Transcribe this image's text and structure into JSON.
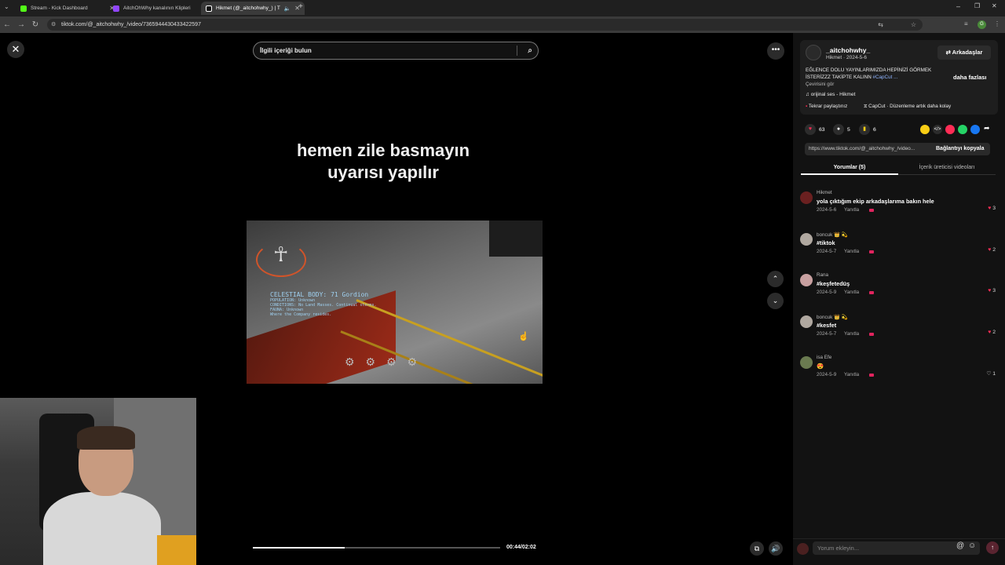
{
  "browser": {
    "tabs": [
      {
        "title": "Stream - Kick Dashboard",
        "color": "#53fc18"
      },
      {
        "title": "AitchOhWhy kanalının Klipleri",
        "color": "#9146ff"
      },
      {
        "title": "Hikmet (@_aitchohwhy_) | T",
        "color": "#ffffff"
      }
    ],
    "url": "tiktok.com/@_aitchohwhy_/video/7365944430433422597",
    "profile_initial": "G"
  },
  "search": {
    "placeholder": "İlgili içeriği bulun"
  },
  "video": {
    "caption_line1": "hemen zile basmayın",
    "caption_line2": "uyarısı yapılır",
    "hud_line1": "CELESTIAL BODY: 71 Gordion",
    "hud_line2": "POPULATION: Unknown",
    "hud_line3": "CONDITIONS: No Land Masses. Continual storms.",
    "hud_line4": "FAUNA: Unknown",
    "hud_line5": "Where the Company resides.",
    "progress": 0.37,
    "time": "00:44/02:02"
  },
  "post": {
    "username": "_aitchohwhy_",
    "meta": "Hikmet · 2024-5-6",
    "friends_label": "Arkadaşlar",
    "description": "EĞLENCE DOLU YAYINLARIMIZDA HEPİNİZİ GÖRMEK İSTERİZZZ TAKİPTE KALINN",
    "hashtag": "#CapCut ...",
    "more_label": "daha fazlası",
    "translate_label": "Çevirisini gör",
    "music": "orijinal ses - Hikmet",
    "repost_label": "Tekrar paylaştınız",
    "capcut_label": "CapCut · Düzenleme artık daha kolay",
    "likes": "63",
    "comments": "5",
    "saves": "6",
    "link": "https://www.tiktok.com/@_aitchohwhy_/video...",
    "copy_label": "Bağlantıyı kopyala",
    "tab_comments": "Yorumlar (5)",
    "tab_creator": "İçerik üreticisi videoları"
  },
  "comments": [
    {
      "user": "Hikmet",
      "text": "yola çıktığım ekip arkadaşlarıma bakın hele",
      "date": "2024-5-6",
      "reply": "Yanıtla",
      "likes": "3",
      "liked": true,
      "avatar_color": "#6a2020"
    },
    {
      "user": "boncuk 👑 💫",
      "text": "#tiktok",
      "date": "2024-5-7",
      "reply": "Yanıtla",
      "likes": "2",
      "liked": true,
      "avatar_color": "#b0a8a0"
    },
    {
      "user": "Rana",
      "text": "#keşfetedüş",
      "date": "2024-5-9",
      "reply": "Yanıtla",
      "likes": "3",
      "liked": true,
      "avatar_color": "#c8a0a0"
    },
    {
      "user": "boncuk 👑 💫",
      "text": "#kesfet",
      "date": "2024-5-7",
      "reply": "Yanıtla",
      "likes": "2",
      "liked": true,
      "avatar_color": "#b0a8a0"
    },
    {
      "user": "isa Efe",
      "text": "😍",
      "date": "2024-5-9",
      "reply": "Yanıtla",
      "likes": "1",
      "liked": false,
      "avatar_color": "#6a7a50"
    }
  ],
  "comment_input": {
    "placeholder": "Yorum ekleyin..."
  }
}
